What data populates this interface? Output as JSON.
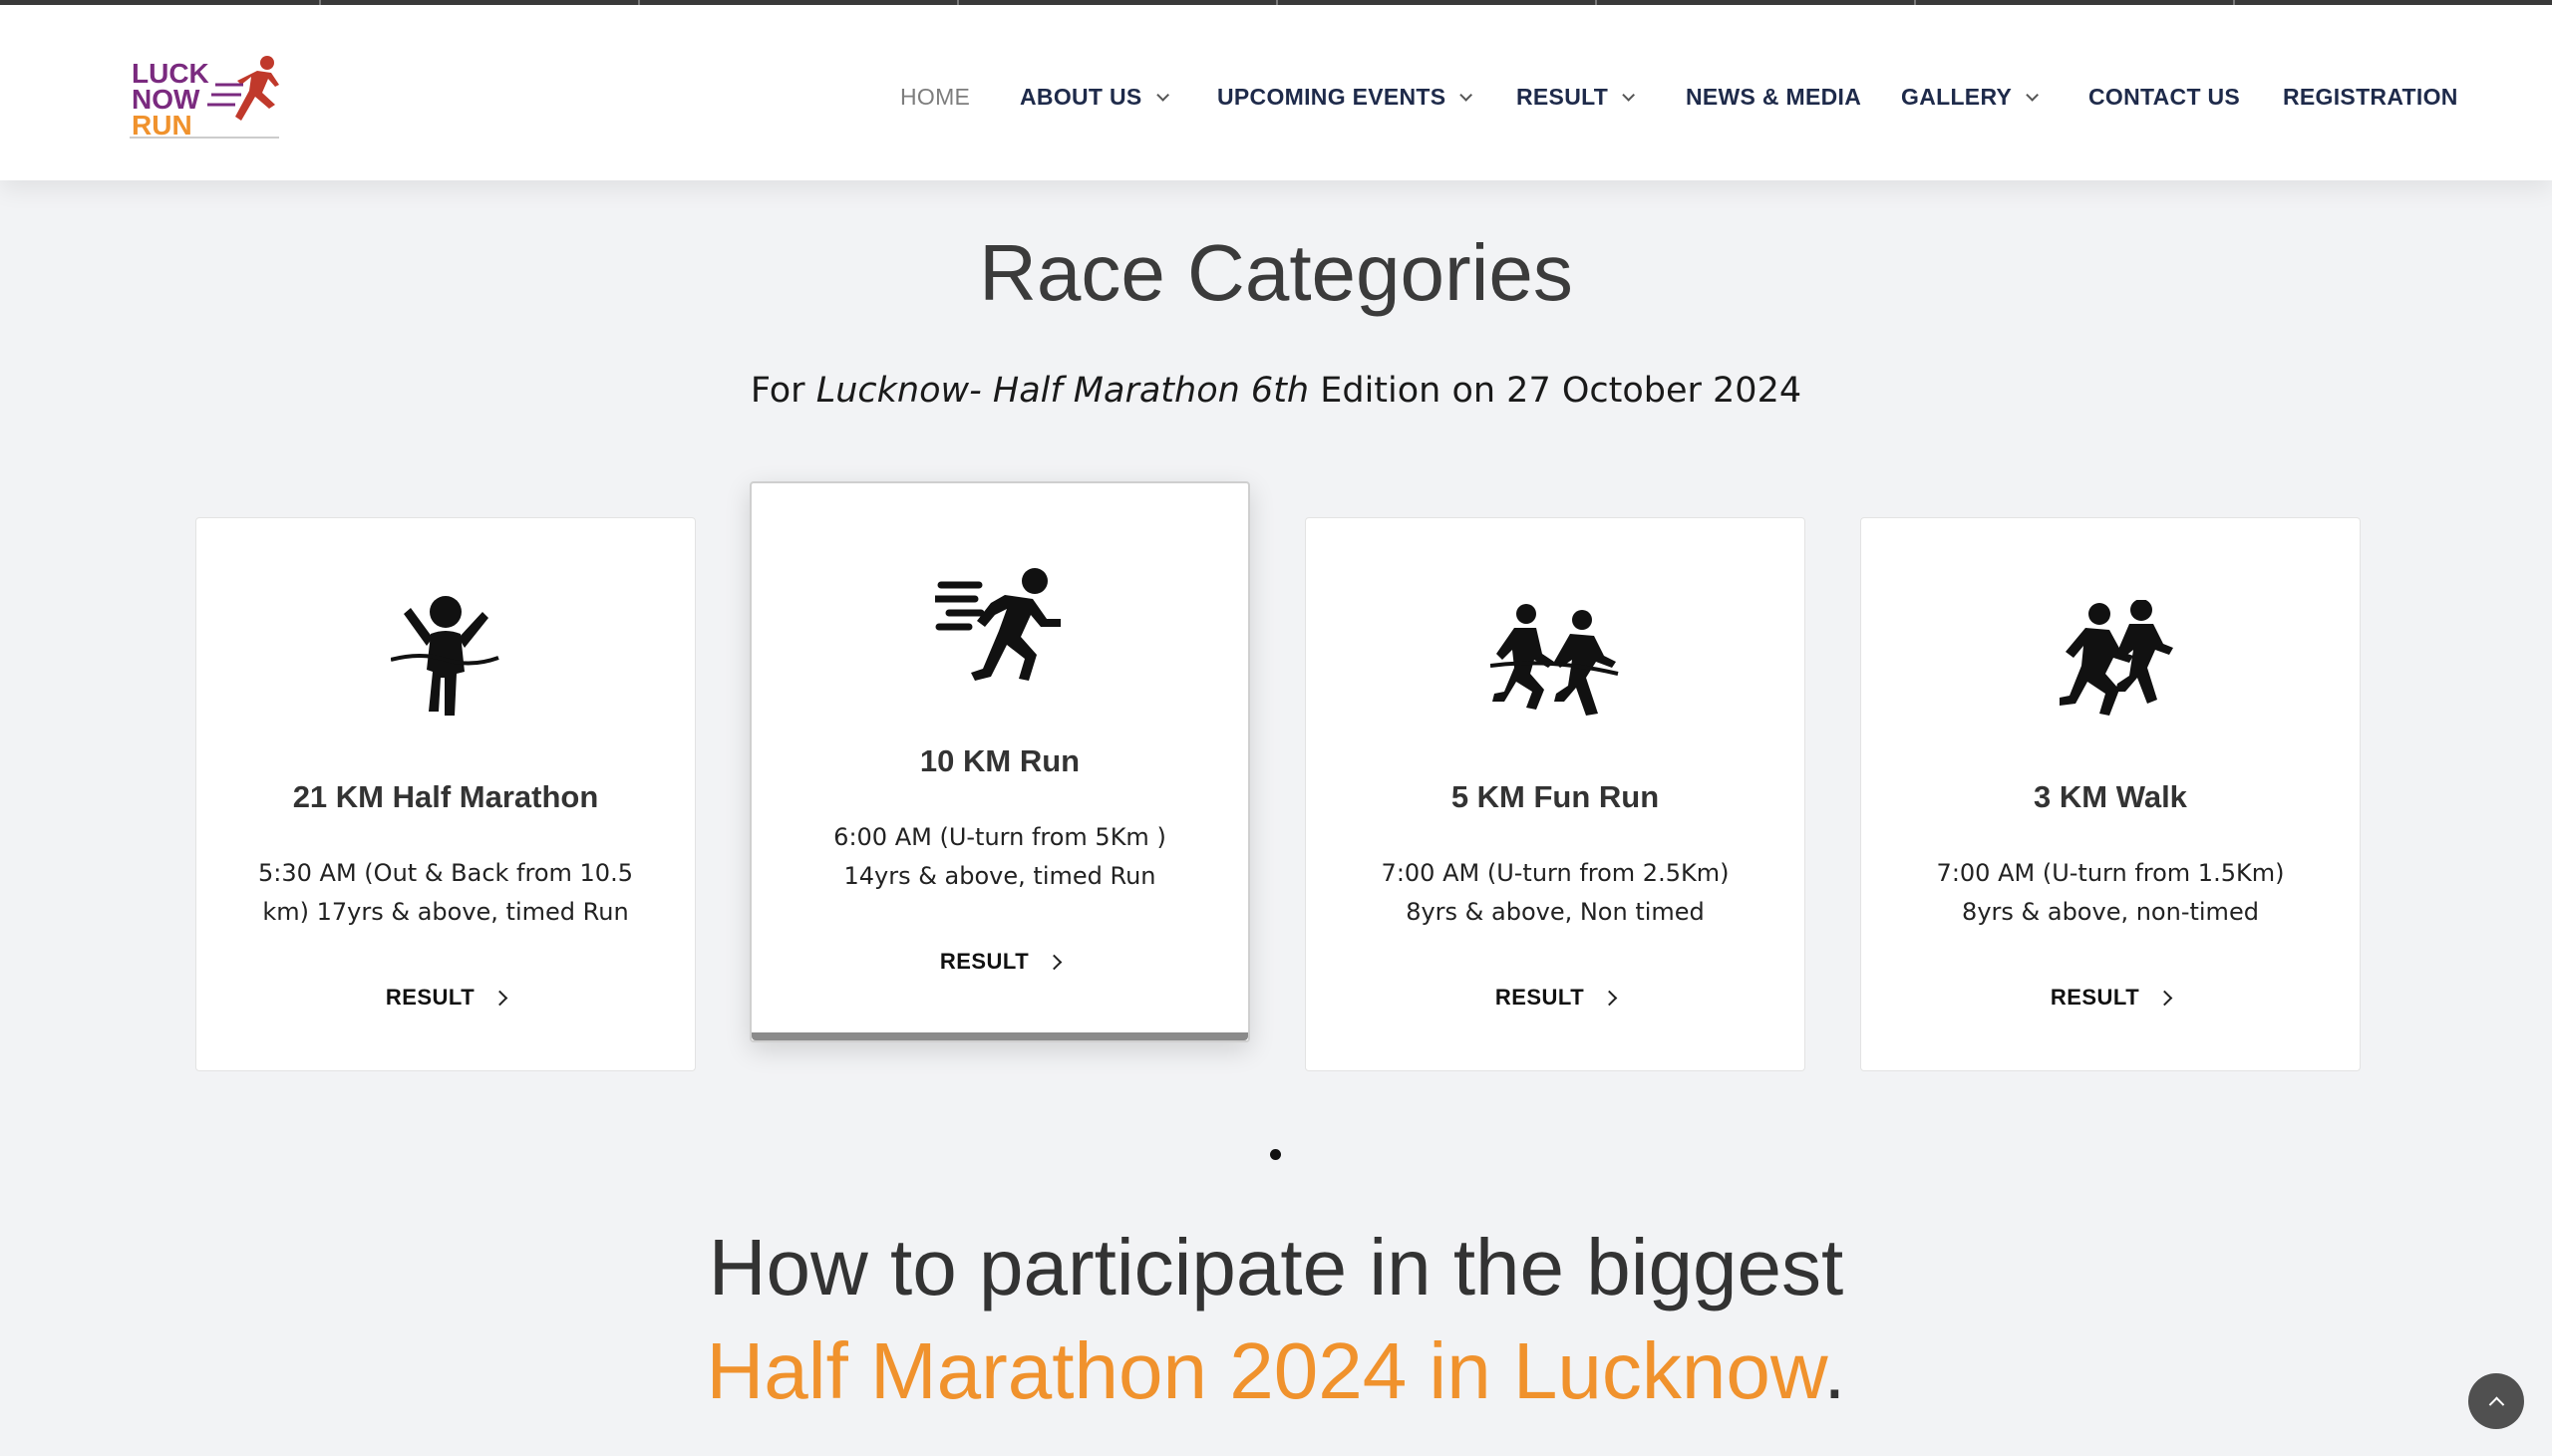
{
  "header": {
    "logo": {
      "line1": "LUCK",
      "line2": "NOW",
      "line3": "RUN",
      "colors": [
        "#7a2a7f",
        "#7a2a7f",
        "#f0922d"
      ]
    },
    "nav": [
      {
        "label": "HOME",
        "active": true,
        "dropdown": false
      },
      {
        "label": "ABOUT US",
        "active": false,
        "dropdown": true
      },
      {
        "label": "UPCOMING EVENTS",
        "active": false,
        "dropdown": true
      },
      {
        "label": "RESULT",
        "active": false,
        "dropdown": true
      },
      {
        "label": "NEWS & MEDIA",
        "active": false,
        "dropdown": false
      },
      {
        "label": "GALLERY",
        "active": false,
        "dropdown": true
      },
      {
        "label": "CONTACT US",
        "active": false,
        "dropdown": false
      },
      {
        "label": "REGISTRATION",
        "active": false,
        "dropdown": false
      }
    ]
  },
  "race": {
    "title": "Race Categories",
    "subtitle_prefix": "For ",
    "subtitle_italic": "Lucknow- Half Marathon 6th",
    "subtitle_suffix": " Edition on 27 October 2024",
    "cards": [
      {
        "icon": "finish-line-runner-icon",
        "title": "21 KM Half Marathon",
        "desc": "5:30 AM (Out & Back from 10.5 km) 17yrs & above, timed Run",
        "link": "RESULT"
      },
      {
        "icon": "fast-runner-icon",
        "title": "10 KM Run",
        "desc": "6:00 AM (U-turn from 5Km ) 14yrs & above, timed Run",
        "link": "RESULT"
      },
      {
        "icon": "race-runners-icon",
        "title": "5 KM Fun Run",
        "desc": "7:00 AM (U-turn from 2.5Km) 8yrs & above, Non timed",
        "link": "RESULT"
      },
      {
        "icon": "running-pair-icon",
        "title": "3 KM Walk",
        "desc": "7:00 AM (U-turn from 1.5Km) 8yrs & above, non-timed",
        "link": "RESULT"
      }
    ]
  },
  "how": {
    "line1": "How to participate in the biggest",
    "line2_accent": "Half Marathon 2024 in Lucknow",
    "line2_end": "."
  },
  "colors": {
    "accent": "#f0922d",
    "nav_text": "#1e2a4a"
  }
}
